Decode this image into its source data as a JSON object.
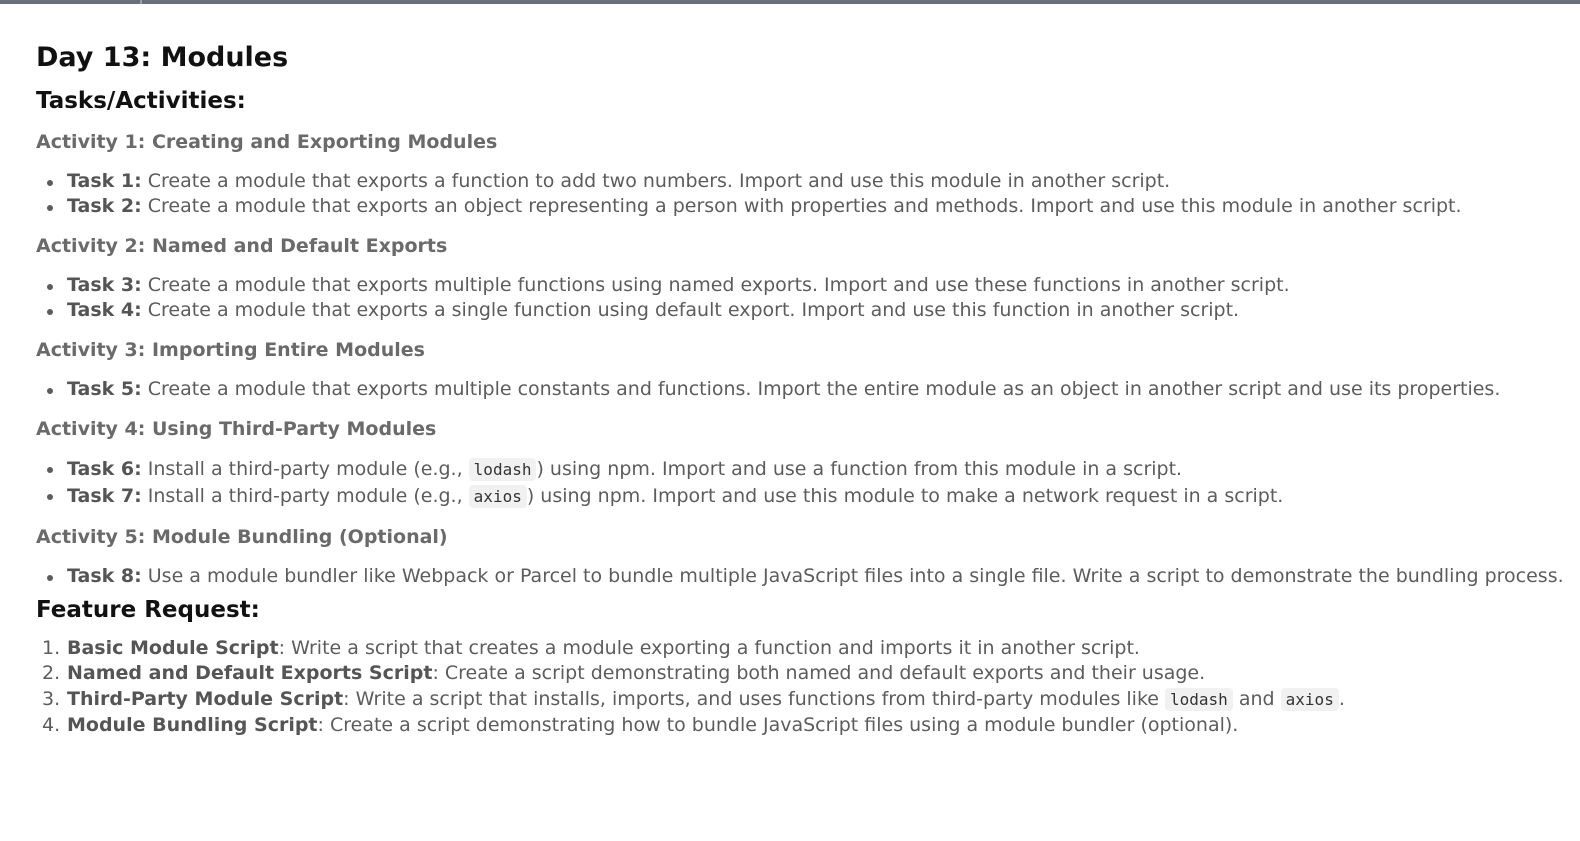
{
  "page": {
    "title": "Day 13: Modules",
    "tasks_heading": "Tasks/Activities:",
    "activities": [
      {
        "title": "Activity 1: Creating and Exporting Modules",
        "tasks": [
          {
            "label": "Task 1:",
            "text": "Create a module that exports a function to add two numbers. Import and use this module in another script."
          },
          {
            "label": "Task 2:",
            "text": "Create a module that exports an object representing a person with properties and methods. Import and use this module in another script."
          }
        ]
      },
      {
        "title": "Activity 2: Named and Default Exports",
        "tasks": [
          {
            "label": "Task 3:",
            "text": "Create a module that exports multiple functions using named exports. Import and use these functions in another script."
          },
          {
            "label": "Task 4:",
            "text": "Create a module that exports a single function using default export. Import and use this function in another script."
          }
        ]
      },
      {
        "title": "Activity 3: Importing Entire Modules",
        "tasks": [
          {
            "label": "Task 5:",
            "text": "Create a module that exports multiple constants and functions. Import the entire module as an object in another script and use its properties."
          }
        ]
      },
      {
        "title": "Activity 4: Using Third-Party Modules",
        "tasks": [
          {
            "label": "Task 6:",
            "pre": "Install a third-party module (e.g.,",
            "code": "lodash",
            "post": ") using npm. Import and use a function from this module in a script."
          },
          {
            "label": "Task 7:",
            "pre": "Install a third-party module (e.g.,",
            "code": "axios",
            "post": ") using npm. Import and use this module to make a network request in a script."
          }
        ]
      },
      {
        "title": "Activity 5: Module Bundling (Optional)",
        "tasks": [
          {
            "label": "Task 8:",
            "text": "Use a module bundler like Webpack or Parcel to bundle multiple JavaScript files into a single file. Write a script to demonstrate the bundling process."
          }
        ]
      }
    ],
    "feature_heading": "Feature Request:",
    "features": [
      {
        "num": "1.",
        "label": "Basic Module Script",
        "text": ": Write a script that creates a module exporting a function and imports it in another script."
      },
      {
        "num": "2.",
        "label": "Named and Default Exports Script",
        "text": ": Create a script demonstrating both named and default exports and their usage."
      },
      {
        "num": "3.",
        "label": "Third-Party Module Script",
        "pre": ": Write a script that installs, imports, and uses functions from third-party modules like",
        "code1": "lodash",
        "mid": "and",
        "code2": "axios",
        "post": "."
      },
      {
        "num": "4.",
        "label": "Module Bundling Script",
        "text": ": Create a script demonstrating how to bundle JavaScript files using a module bundler (optional)."
      }
    ]
  }
}
